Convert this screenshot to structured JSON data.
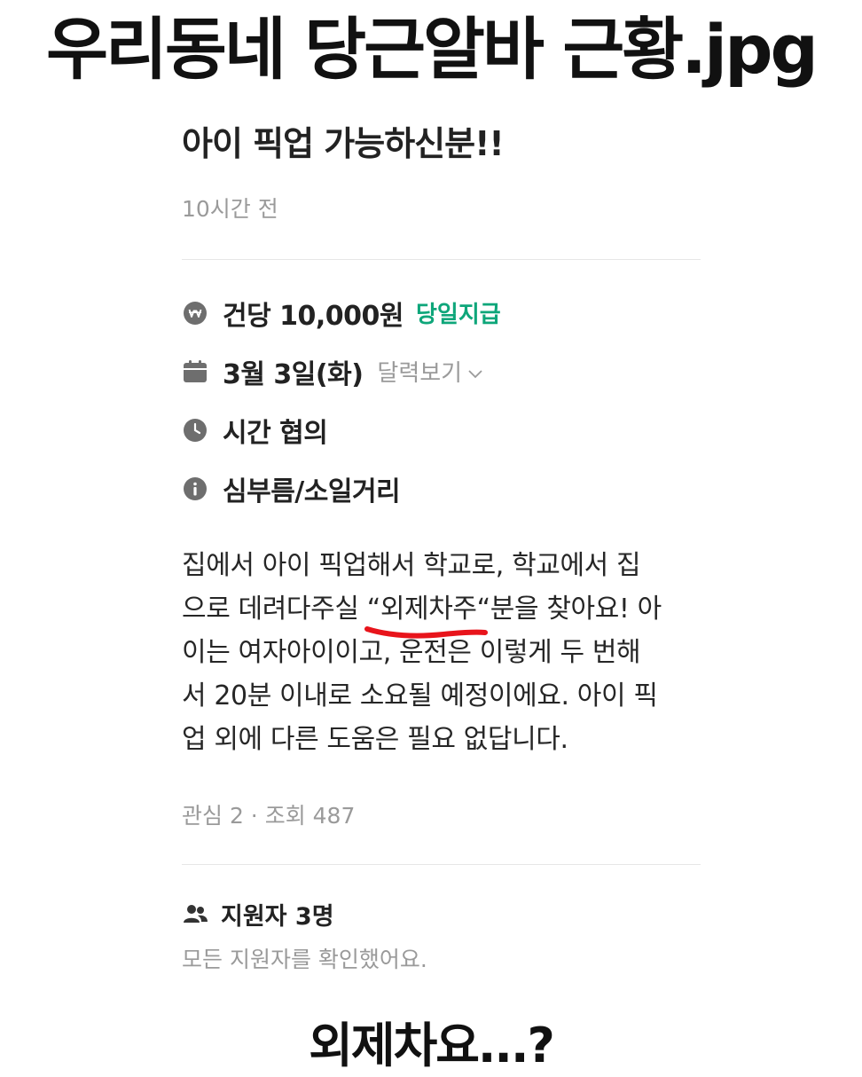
{
  "meme": {
    "title": "우리동네 당근알바 근황.jpg",
    "caption": "외제차요...?"
  },
  "post": {
    "title": "아이 픽업 가능하신분!!",
    "time": "10시간 전",
    "pay": {
      "icon": "won-icon",
      "amount": "건당 10,000원",
      "badge": "당일지급",
      "badge_color": "#0ea67a"
    },
    "date": {
      "icon": "calendar-icon",
      "value": "3월 3일(화)",
      "link_label": "달력보기"
    },
    "time_info": {
      "icon": "clock-icon",
      "value": "시간 협의"
    },
    "location": {
      "icon": "info-icon",
      "value": "심부름/소일거리"
    },
    "description": {
      "part1": "집에서 아이 픽업해서 학교로, 학교에서 집\n으로 데려다주실 ",
      "highlight": "“외제차주",
      "part2": "“분을 찾아요! 아\n이는 여자아이이고, 운전은 이렇게 두 번해\n서 20분 이내로 소요될 예정이에요. 아이 픽\n업 외에 다른 도움은 필요 없답니다.",
      "underline_color": "#e8141b"
    },
    "stats": "관심 2 · 조회 487",
    "applicants": {
      "icon": "people-icon",
      "title": "지원자 3명",
      "subtitle": "모든 지원자를 확인했어요."
    }
  }
}
